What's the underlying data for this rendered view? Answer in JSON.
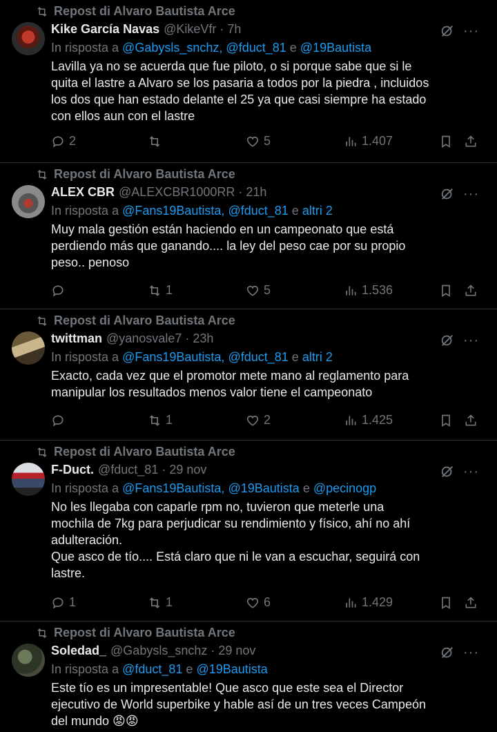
{
  "repost_label": "Repost di Alvaro Bautista Arce",
  "reply_prefix": "In risposta a",
  "reply_and": "e",
  "tweets": [
    {
      "name": "Kike García Navas",
      "handle": "@KikeVfr · 7h",
      "mentions": [
        "@Gabysls_snchz,",
        "@fduct_81"
      ],
      "last_mention": "@19Bautista",
      "text": "Lavilla ya no se acuerda que fue piloto, o si porque sabe que si le\nquita el lastre a Alvaro se los pasaria a todos por la piedra , incluidos\nlos dos que han estado delante el 25 ya que casi siempre ha estado\ncon ellos aun con el lastre",
      "replies": "2",
      "reposts": "",
      "likes": "5",
      "views": "1.407"
    },
    {
      "name": "ALEX CBR",
      "handle": "@ALEXCBR1000RR · 21h",
      "mentions": [
        "@Fans19Bautista,",
        "@fduct_81"
      ],
      "last_mention": "altri 2",
      "text": "Muy mala gestión están haciendo en un campeonato que está\nperdiendo más que ganando.... la ley del peso cae por su propio\npeso.. penoso",
      "replies": "",
      "reposts": "1",
      "likes": "5",
      "views": "1.536"
    },
    {
      "name": "twittman",
      "handle": "@yanosvale7 · 23h",
      "mentions": [
        "@Fans19Bautista,",
        "@fduct_81"
      ],
      "last_mention": "altri 2",
      "text": "Exacto, cada vez que el promotor mete mano al reglamento para\nmanipular los resultados menos valor tiene el campeonato",
      "replies": "",
      "reposts": "1",
      "likes": "2",
      "views": "1.425"
    },
    {
      "name": "F-Duct.",
      "handle": "@fduct_81 · 29 nov",
      "mentions": [
        "@Fans19Bautista,",
        "@19Bautista"
      ],
      "last_mention": "@pecinogp",
      "text": "No les llegaba con caparle rpm no, tuvieron que meterle una\nmochila de 7kg para perjudicar su rendimiento y físico, ahí no ahí\nadulteración.\nQue asco de tío.... Está claro que ni le van a escuchar, seguirá con\nlastre.",
      "replies": "1",
      "reposts": "1",
      "likes": "6",
      "views": "1.429"
    },
    {
      "name": "Soledad_",
      "handle": "@Gabysls_snchz · 29 nov",
      "mentions": [
        "@fduct_81"
      ],
      "last_mention": "@19Bautista",
      "text": "Este tío es un impresentable! Que asco que este sea el Director\nejecutivo de World superbike y hable así de un tres veces Campeón\ndel mundo 😡😡",
      "replies": "",
      "reposts": "",
      "likes": "",
      "views": ""
    }
  ]
}
